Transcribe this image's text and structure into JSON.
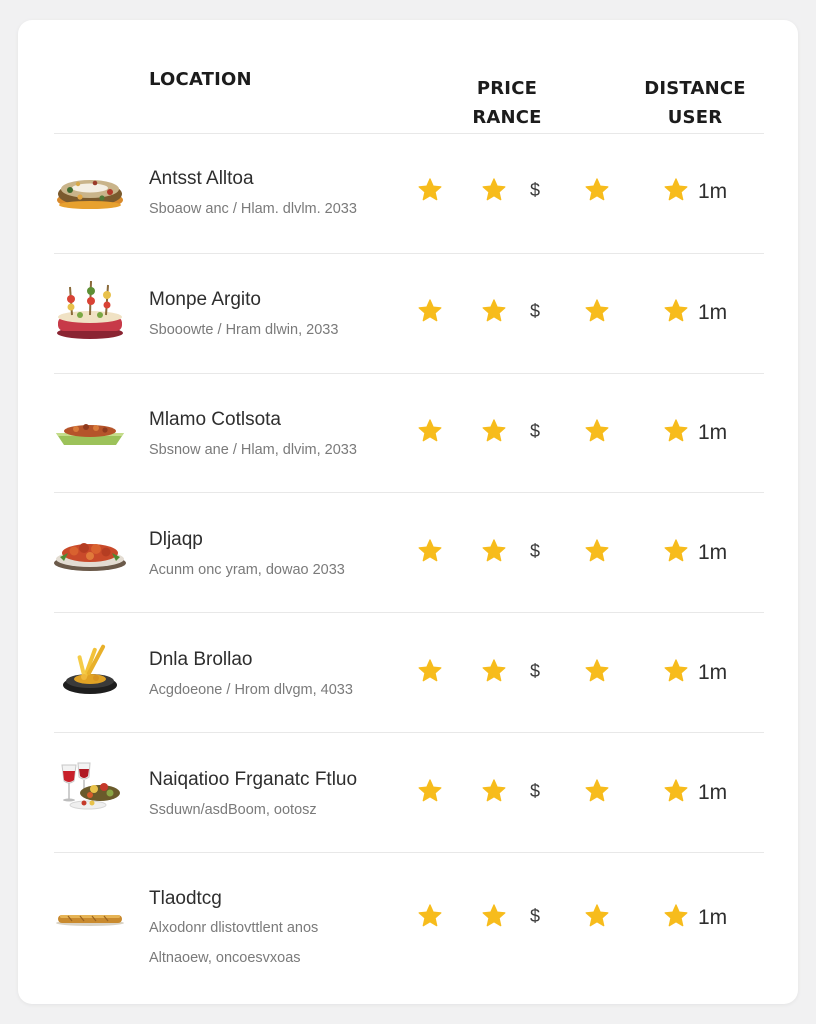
{
  "header": {
    "location": "LOCATION",
    "price_line1": "PRICE",
    "price_line2": "RANCE",
    "distance_line1": "DISTANCE",
    "distance_line2": "USER"
  },
  "colors": {
    "star": "#f7bc1c",
    "text": "#2e2e2e",
    "subtext": "#7a7a7a",
    "divider": "#e8e8e8"
  },
  "rows": [
    {
      "name": "Antsst Alltoa",
      "sub": "Sboaow anc / Hlam. dlvlm. 2033",
      "sub2": "",
      "price_symbol": "$",
      "distance": "1m",
      "icon": "wreath-dish-icon"
    },
    {
      "name": "Monpe Argito",
      "sub": "Sbooowte / Hram dlwin, 2033",
      "sub2": "",
      "price_symbol": "$",
      "distance": "1m",
      "icon": "skewer-platter-icon"
    },
    {
      "name": "Mlamo Cotlsota",
      "sub": "Sbsnow ane / Hlam, dlvim, 2033",
      "sub2": "",
      "price_symbol": "$",
      "distance": "1m",
      "icon": "green-tray-icon"
    },
    {
      "name": "Dljaqp",
      "sub": "Acunm onc yram, dowao 2033",
      "sub2": "",
      "price_symbol": "$",
      "distance": "1m",
      "icon": "roast-platter-icon"
    },
    {
      "name": "Dnla Brollao",
      "sub": "Acgdoeone / Hrom dlvgm, 4033",
      "sub2": "",
      "price_symbol": "$",
      "distance": "1m",
      "icon": "fries-bowl-icon"
    },
    {
      "name": "Naiqatioo Frganatc Ftluo",
      "sub": "Ssduwn/asdBoom, ootosz",
      "sub2": "",
      "price_symbol": "$",
      "distance": "1m",
      "icon": "wine-glasses-icon"
    },
    {
      "name": "Tlaodtcg",
      "sub": "Alxodonr dlistovttlent anos",
      "sub2": "Altnaoew, oncoesvxoas",
      "price_symbol": "$",
      "distance": "1m",
      "icon": "baguette-icon"
    }
  ]
}
